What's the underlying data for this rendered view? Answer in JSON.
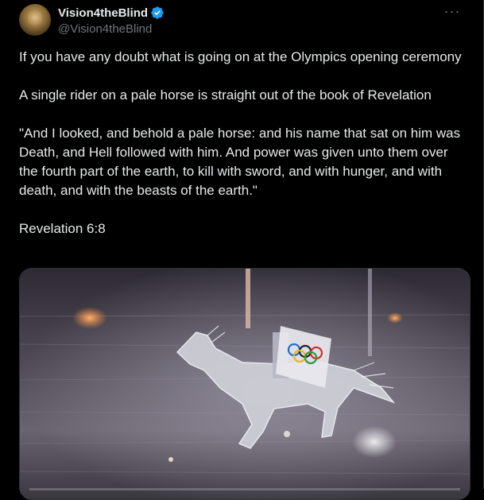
{
  "tweet": {
    "author": {
      "display_name": "Vision4theBlind",
      "handle": "@Vision4theBlind",
      "verified": true,
      "verified_color": "#1d9bf0"
    },
    "more_label": "···",
    "paragraphs": [
      "If you have any doubt what is going on at the Olympics opening ceremony",
      "A single rider on a pale horse is straight out of the book of Revelation",
      "\"And I looked, and behold a pale horse: and his name that sat on him was Death, and Hell followed with him. And power was given unto them over the fourth part of the earth, to kill with sword, and with hunger, and with death, and with the beasts of the earth.\"",
      "Revelation 6:8"
    ],
    "media": {
      "icon": "video-thumbnail-icon"
    }
  },
  "colors": {
    "background": "#000000",
    "text": "#e7e9ea",
    "secondary": "#71767b",
    "border": "#2f3336"
  }
}
